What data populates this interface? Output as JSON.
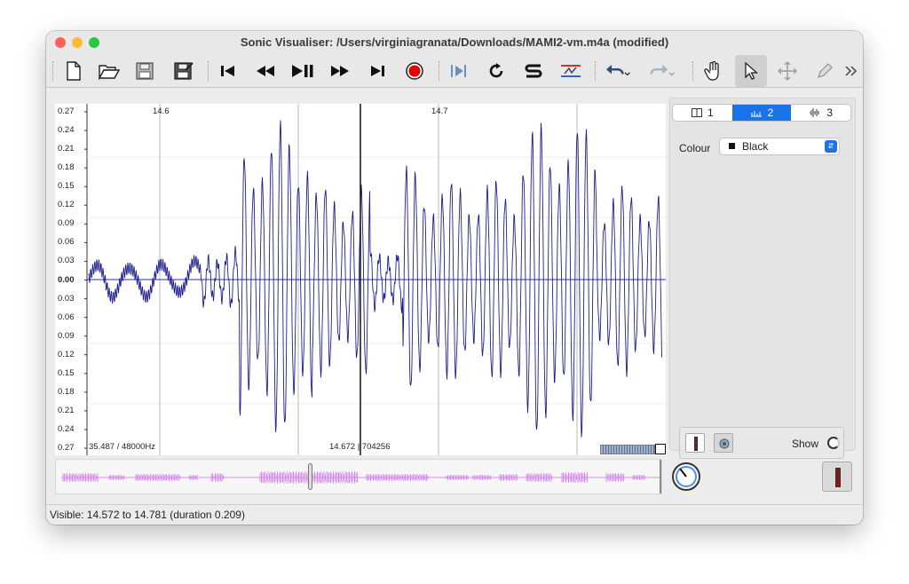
{
  "window": {
    "title": "Sonic Visualiser: /Users/virginiagranata/Downloads/MAMI2-vm.m4a (modified)"
  },
  "toolbar": {
    "icons": [
      "new-file-icon",
      "open-folder-icon",
      "save-icon",
      "save-as-icon",
      "rewind-start-icon",
      "rewind-icon",
      "play-pause-icon",
      "fast-forward-icon",
      "skip-end-icon",
      "record-icon",
      "play-selection-icon",
      "loop-icon",
      "solo-icon",
      "normalize-icon",
      "undo-icon",
      "redo-icon",
      "navigate-hand-icon",
      "select-arrow-icon",
      "move-icon",
      "draw-pencil-icon",
      "more-icon"
    ]
  },
  "waveform": {
    "y_labels": [
      "0.27",
      "0.24",
      "0.21",
      "0.18",
      "0.15",
      "0.12",
      "0.09",
      "0.06",
      "0.03",
      "0.00",
      "0.03",
      "0.06",
      "0.09",
      "0.12",
      "0.15",
      "0.18",
      "0.21",
      "0.24",
      "0.27"
    ],
    "time_labels": [
      "14.6",
      "14.7"
    ],
    "sample_rate_text": "35.487 / 48000Hz",
    "cursor_text": "14.672 | 704256",
    "wave_color": "#1f1f8f",
    "overview_color": "#d58ee8"
  },
  "layer_tabs": [
    {
      "label": "1"
    },
    {
      "label": "2"
    },
    {
      "label": "3"
    }
  ],
  "properties": {
    "colour_label": "Colour",
    "colour_value": "Black",
    "show_label": "Show"
  },
  "status": {
    "text": "Visible: 14.572 to 14.781 (duration 0.209)"
  }
}
